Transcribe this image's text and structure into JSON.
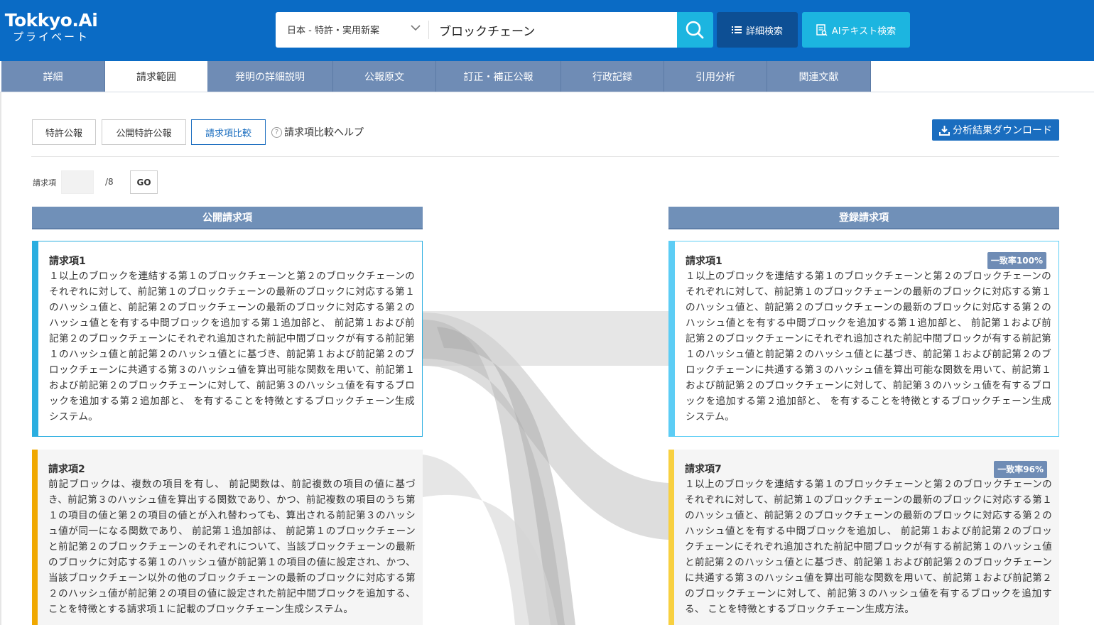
{
  "logo": {
    "line1": "Tokkyo.Ai",
    "line2": "プライベート"
  },
  "search": {
    "scope": "日本 - 特許・実用新案",
    "query": "ブロックチェーン"
  },
  "buttons": {
    "advanced": "詳細検索",
    "ai_text": "AIテキスト検索"
  },
  "tabs": [
    "詳細",
    "請求範囲",
    "発明の詳細説明",
    "公報原文",
    "訂正・補正公報",
    "行政記録",
    "引用分析",
    "関連文献"
  ],
  "active_tab": "請求範囲",
  "sub_tabs": [
    "特許公報",
    "公開特許公報",
    "請求項比較"
  ],
  "active_sub_tab": "請求項比較",
  "help_label": "請求項比較ヘルプ",
  "download_label": "分析結果ダウンロード",
  "claim_nav": {
    "label": "請求項",
    "value": "",
    "total": "/8",
    "go": "GO"
  },
  "left_column": {
    "header": "公開請求項",
    "cards": [
      {
        "title": "請求項1",
        "color": "#2aaee0",
        "text": "１以上のブロックを連結する第１のブロックチェーンと第２のブロックチェーンのそれぞれに対して、前記第１のブロックチェーンの最新のブロックに対応する第１のハッシュ値と、前記第２のブロックチェーンの最新のブロックに対応する第２のハッシュ値とを有する中間ブロックを追加する第１追加部と、 前記第１および前記第２のブロックチェーンにそれぞれ追加された前記中間ブロックが有する前記第１のハッシュ値と前記第２のハッシュ値とに基づき、前記第１および前記第２のブロックチェーンに共通する第３のハッシュ値を算出可能な関数を用いて、前記第１および前記第２のブロックチェーンに対して、前記第３のハッシュ値を有するブロックを追加する第２追加部と、 を有することを特徴とするブロックチェーン生成システム。"
      },
      {
        "title": "請求項2",
        "color": "#f0a800",
        "text": "前記ブロックは、複数の項目を有し、 前記関数は、前記複数の項目の値に基づき、前記第３のハッシュ値を算出する関数であり、かつ、前記複数の項目のうち第１の項目の値と第２の項目の値とが入れ替わっても、算出される前記第３のハッシュ値が同一になる関数であり、 前記第１追加部は、 前記第１のブロックチェーンと前記第２のブロックチェーンのそれぞれについて、当該ブロックチェーンの最新のブロックに対応する第１のハッシュ値が前記第１の項目の値に設定され、かつ、当該ブロックチェーン以外の他のブロックチェーンの最新のブロックに対応する第２のハッシュ値が前記第２の項目の値に設定された前記中間ブロックを追加する、ことを特徴とする請求項１に記載のブロックチェーン生成システム。"
      }
    ]
  },
  "right_column": {
    "header": "登録請求項",
    "cards": [
      {
        "title": "請求項1",
        "badge": "一致率100%",
        "color": "#5ccdf5",
        "text": "１以上のブロックを連結する第１のブロックチェーンと第２のブロックチェーンのそれぞれに対して、前記第１のブロックチェーンの最新のブロックに対応する第１のハッシュ値と、前記第２のブロックチェーンの最新のブロックに対応する第２のハッシュ値とを有する中間ブロックを追加する第１追加部と、 前記第１および前記第２のブロックチェーンにそれぞれ追加された前記中間ブロックが有する前記第１のハッシュ値と前記第２のハッシュ値とに基づき、前記第１および前記第２のブロックチェーンに共通する第３のハッシュ値を算出可能な関数を用いて、前記第１および前記第２のブロックチェーンに対して、前記第３のハッシュ値を有するブロックを追加する第２追加部と、 を有することを特徴とするブロックチェーン生成システム。"
      },
      {
        "title": "請求項7",
        "badge": "一致率96%",
        "color": "#f8d040",
        "text": "１以上のブロックを連結する第１のブロックチェーンと第２のブロックチェーンのそれぞれに対して、前記第１のブロックチェーンの最新のブロックに対応する第１のハッシュ値と、前記第２のブロックチェーンの最新のブロックに対応する第２のハッシュ値とを有する中間ブロックを追加し、 前記第１および前記第２のブロックチェーンにそれぞれ追加された前記中間ブロックが有する前記第１のハッシュ値と前記第２のハッシュ値とに基づき、前記第１および前記第２のブロックチェーンに共通する第３のハッシュ値を算出可能な関数を用いて、前記第１および前記第２のブロックチェーンに対して、前記第３のハッシュ値を有するブロックを追加する、 ことを特徴とするブロックチェーン生成方法。"
      }
    ]
  },
  "colors": {
    "brand": "#0a6bc5",
    "accent": "#1cb5e0",
    "tab_bg": "#6f8cb5",
    "dark_button": "#0d4f94"
  }
}
